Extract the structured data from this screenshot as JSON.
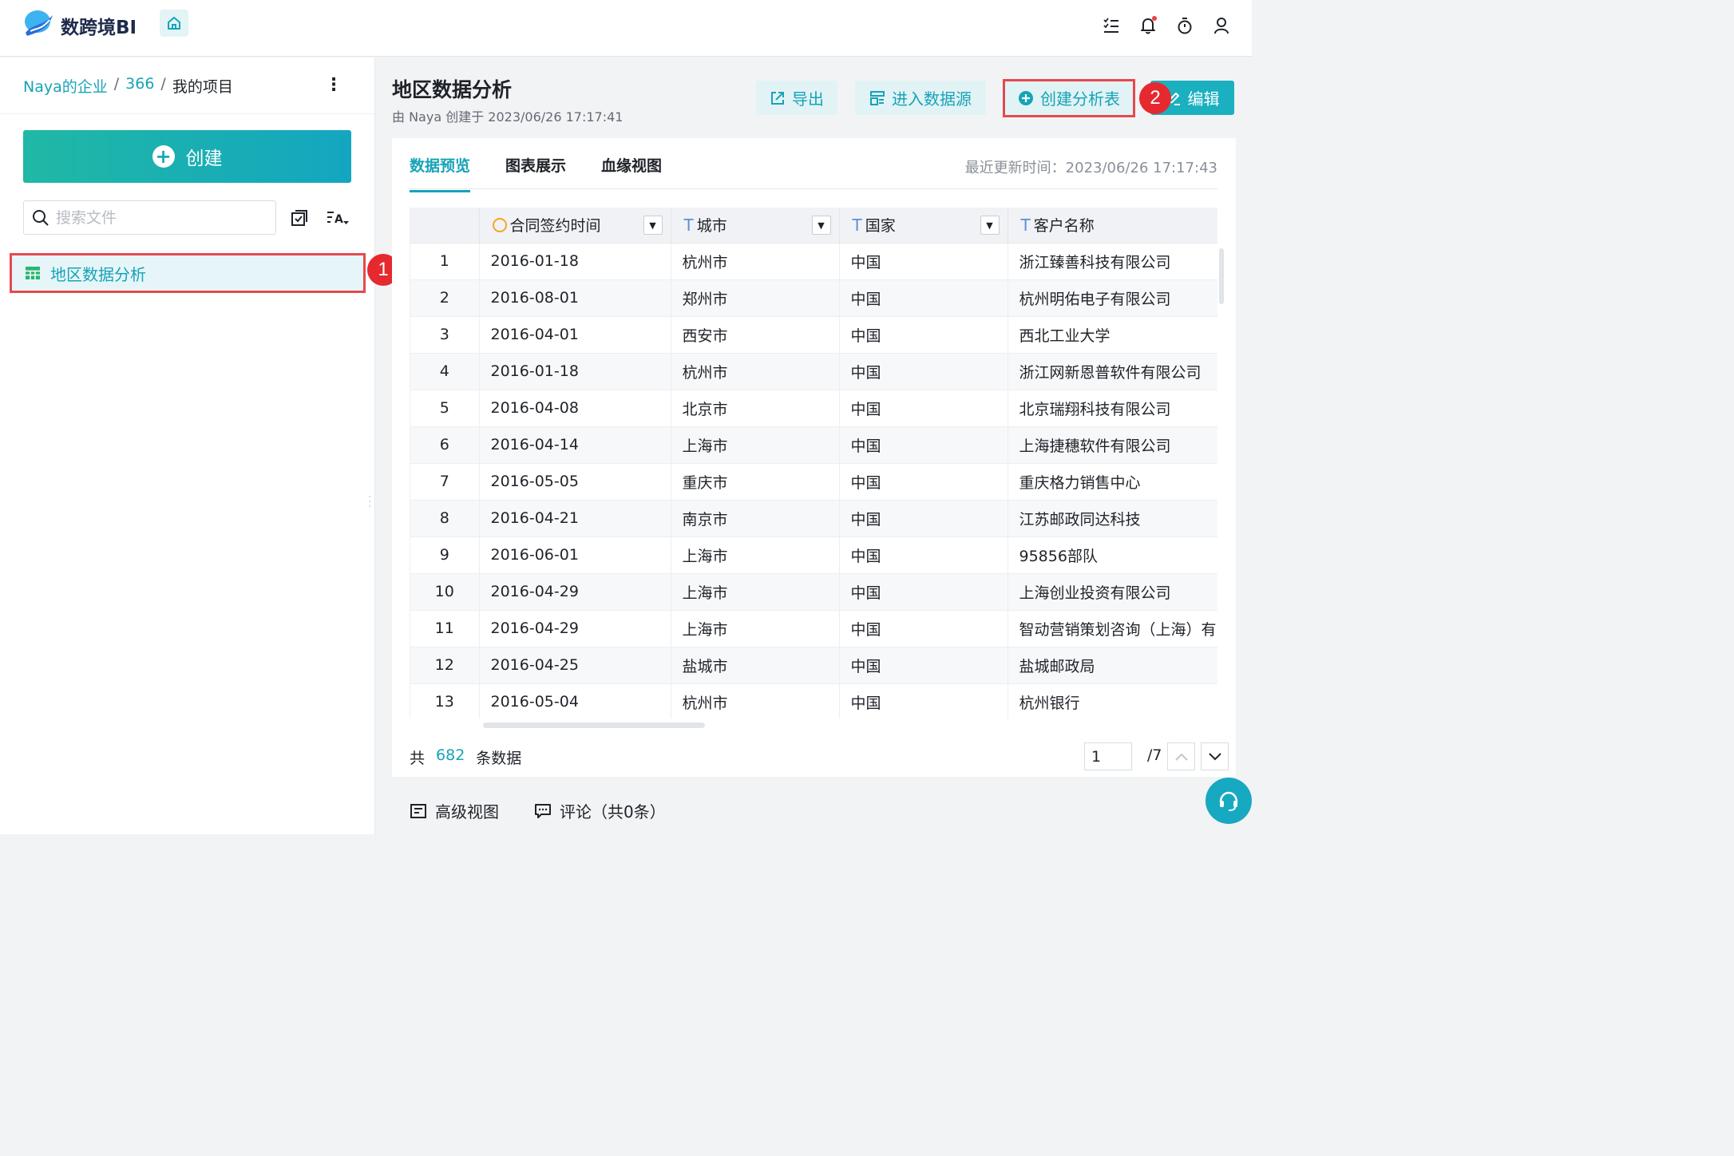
{
  "header": {
    "brand": "数跨境BI",
    "icons": [
      "checklist-icon",
      "bell-icon",
      "timer-icon",
      "user-icon"
    ]
  },
  "sidebar": {
    "breadcrumb": [
      "Naya的企业",
      "366",
      "我的项目"
    ],
    "breadcrumb_sep": "/",
    "create_label": "创建",
    "search_placeholder": "搜索文件",
    "file_item": "地区数据分析",
    "annotation_1": "1"
  },
  "main": {
    "title": "地区数据分析",
    "subtitle": "由 Naya 创建于 2023/06/26 17:17:41",
    "buttons": {
      "export": "导出",
      "datasource": "进入数据源",
      "create_analysis": "创建分析表",
      "edit": "编辑"
    },
    "annotation_2": "2",
    "tabs": [
      "数据预览",
      "图表展示",
      "血缘视图"
    ],
    "updated": "最近更新时间：2023/06/26 17:17:43",
    "columns": [
      "合同签约时间",
      "城市",
      "国家",
      "客户名称"
    ],
    "rows": [
      [
        "1",
        "2016-01-18",
        "杭州市",
        "中国",
        "浙江臻善科技有限公司"
      ],
      [
        "2",
        "2016-08-01",
        "郑州市",
        "中国",
        "杭州明佑电子有限公司"
      ],
      [
        "3",
        "2016-04-01",
        "西安市",
        "中国",
        "西北工业大学"
      ],
      [
        "4",
        "2016-01-18",
        "杭州市",
        "中国",
        "浙江网新恩普软件有限公司"
      ],
      [
        "5",
        "2016-04-08",
        "北京市",
        "中国",
        "北京瑞翔科技有限公司"
      ],
      [
        "6",
        "2016-04-14",
        "上海市",
        "中国",
        "上海捷穗软件有限公司"
      ],
      [
        "7",
        "2016-05-05",
        "重庆市",
        "中国",
        "重庆格力销售中心"
      ],
      [
        "8",
        "2016-04-21",
        "南京市",
        "中国",
        "江苏邮政同达科技"
      ],
      [
        "9",
        "2016-06-01",
        "上海市",
        "中国",
        "95856部队"
      ],
      [
        "10",
        "2016-04-29",
        "上海市",
        "中国",
        "上海创业投资有限公司"
      ],
      [
        "11",
        "2016-04-29",
        "上海市",
        "中国",
        "智动营销策划咨询（上海）有"
      ],
      [
        "12",
        "2016-04-25",
        "盐城市",
        "中国",
        "盐城邮政局"
      ],
      [
        "13",
        "2016-05-04",
        "杭州市",
        "中国",
        "杭州银行"
      ]
    ],
    "footer": {
      "count_prefix": "共",
      "count": "682",
      "count_suffix": "条数据",
      "page": "1",
      "page_total": "/7"
    }
  },
  "bottom": {
    "advanced_view": "高级视图",
    "comments": "评论（共0条）"
  },
  "colors": {
    "accent": "#16a3b8",
    "highlight_border": "#e5494d",
    "badge": "#e5292f"
  }
}
